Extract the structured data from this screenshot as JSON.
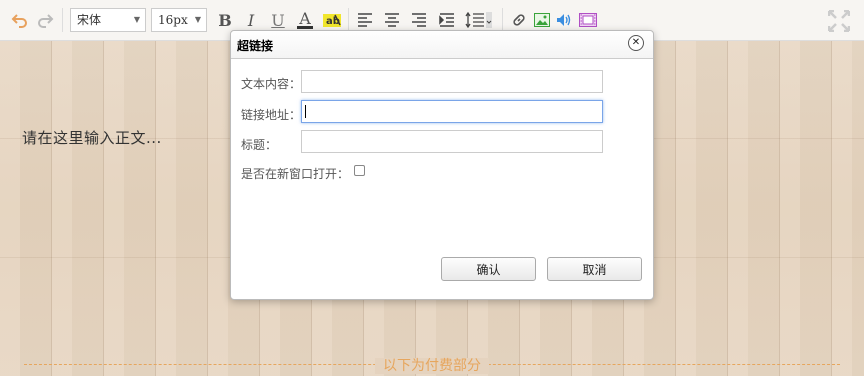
{
  "toolbar": {
    "font_family": "宋体",
    "font_size": "16px",
    "bold_label": "B",
    "italic_label": "I",
    "underline_label": "U",
    "fontcolor_label": "A",
    "icons": [
      "undo-icon",
      "redo-icon",
      "bold-icon",
      "italic-icon",
      "underline-icon",
      "font-color-icon",
      "highlight-icon",
      "align-left-icon",
      "align-center-icon",
      "align-right-icon",
      "indent-icon",
      "line-height-icon",
      "link-icon",
      "image-icon",
      "audio-icon",
      "video-icon",
      "fullscreen-icon"
    ]
  },
  "editor": {
    "placeholder_text": "请在这里输入正文...",
    "paid_divider_label": "以下为付费部分"
  },
  "dialog": {
    "title": "超链接",
    "fields": {
      "text_label": "文本内容：",
      "url_label": "链接地址：",
      "title_label": "标题：",
      "newwindow_label": "是否在新窗口打开："
    },
    "values": {
      "text": "",
      "url": "",
      "title": ""
    },
    "confirm_label": "确认",
    "cancel_label": "取消"
  },
  "colors": {
    "accent": "#e6a65d",
    "focus": "#7aa5e8",
    "undo": "#e8a15d",
    "highlight": "#f1e62c"
  }
}
